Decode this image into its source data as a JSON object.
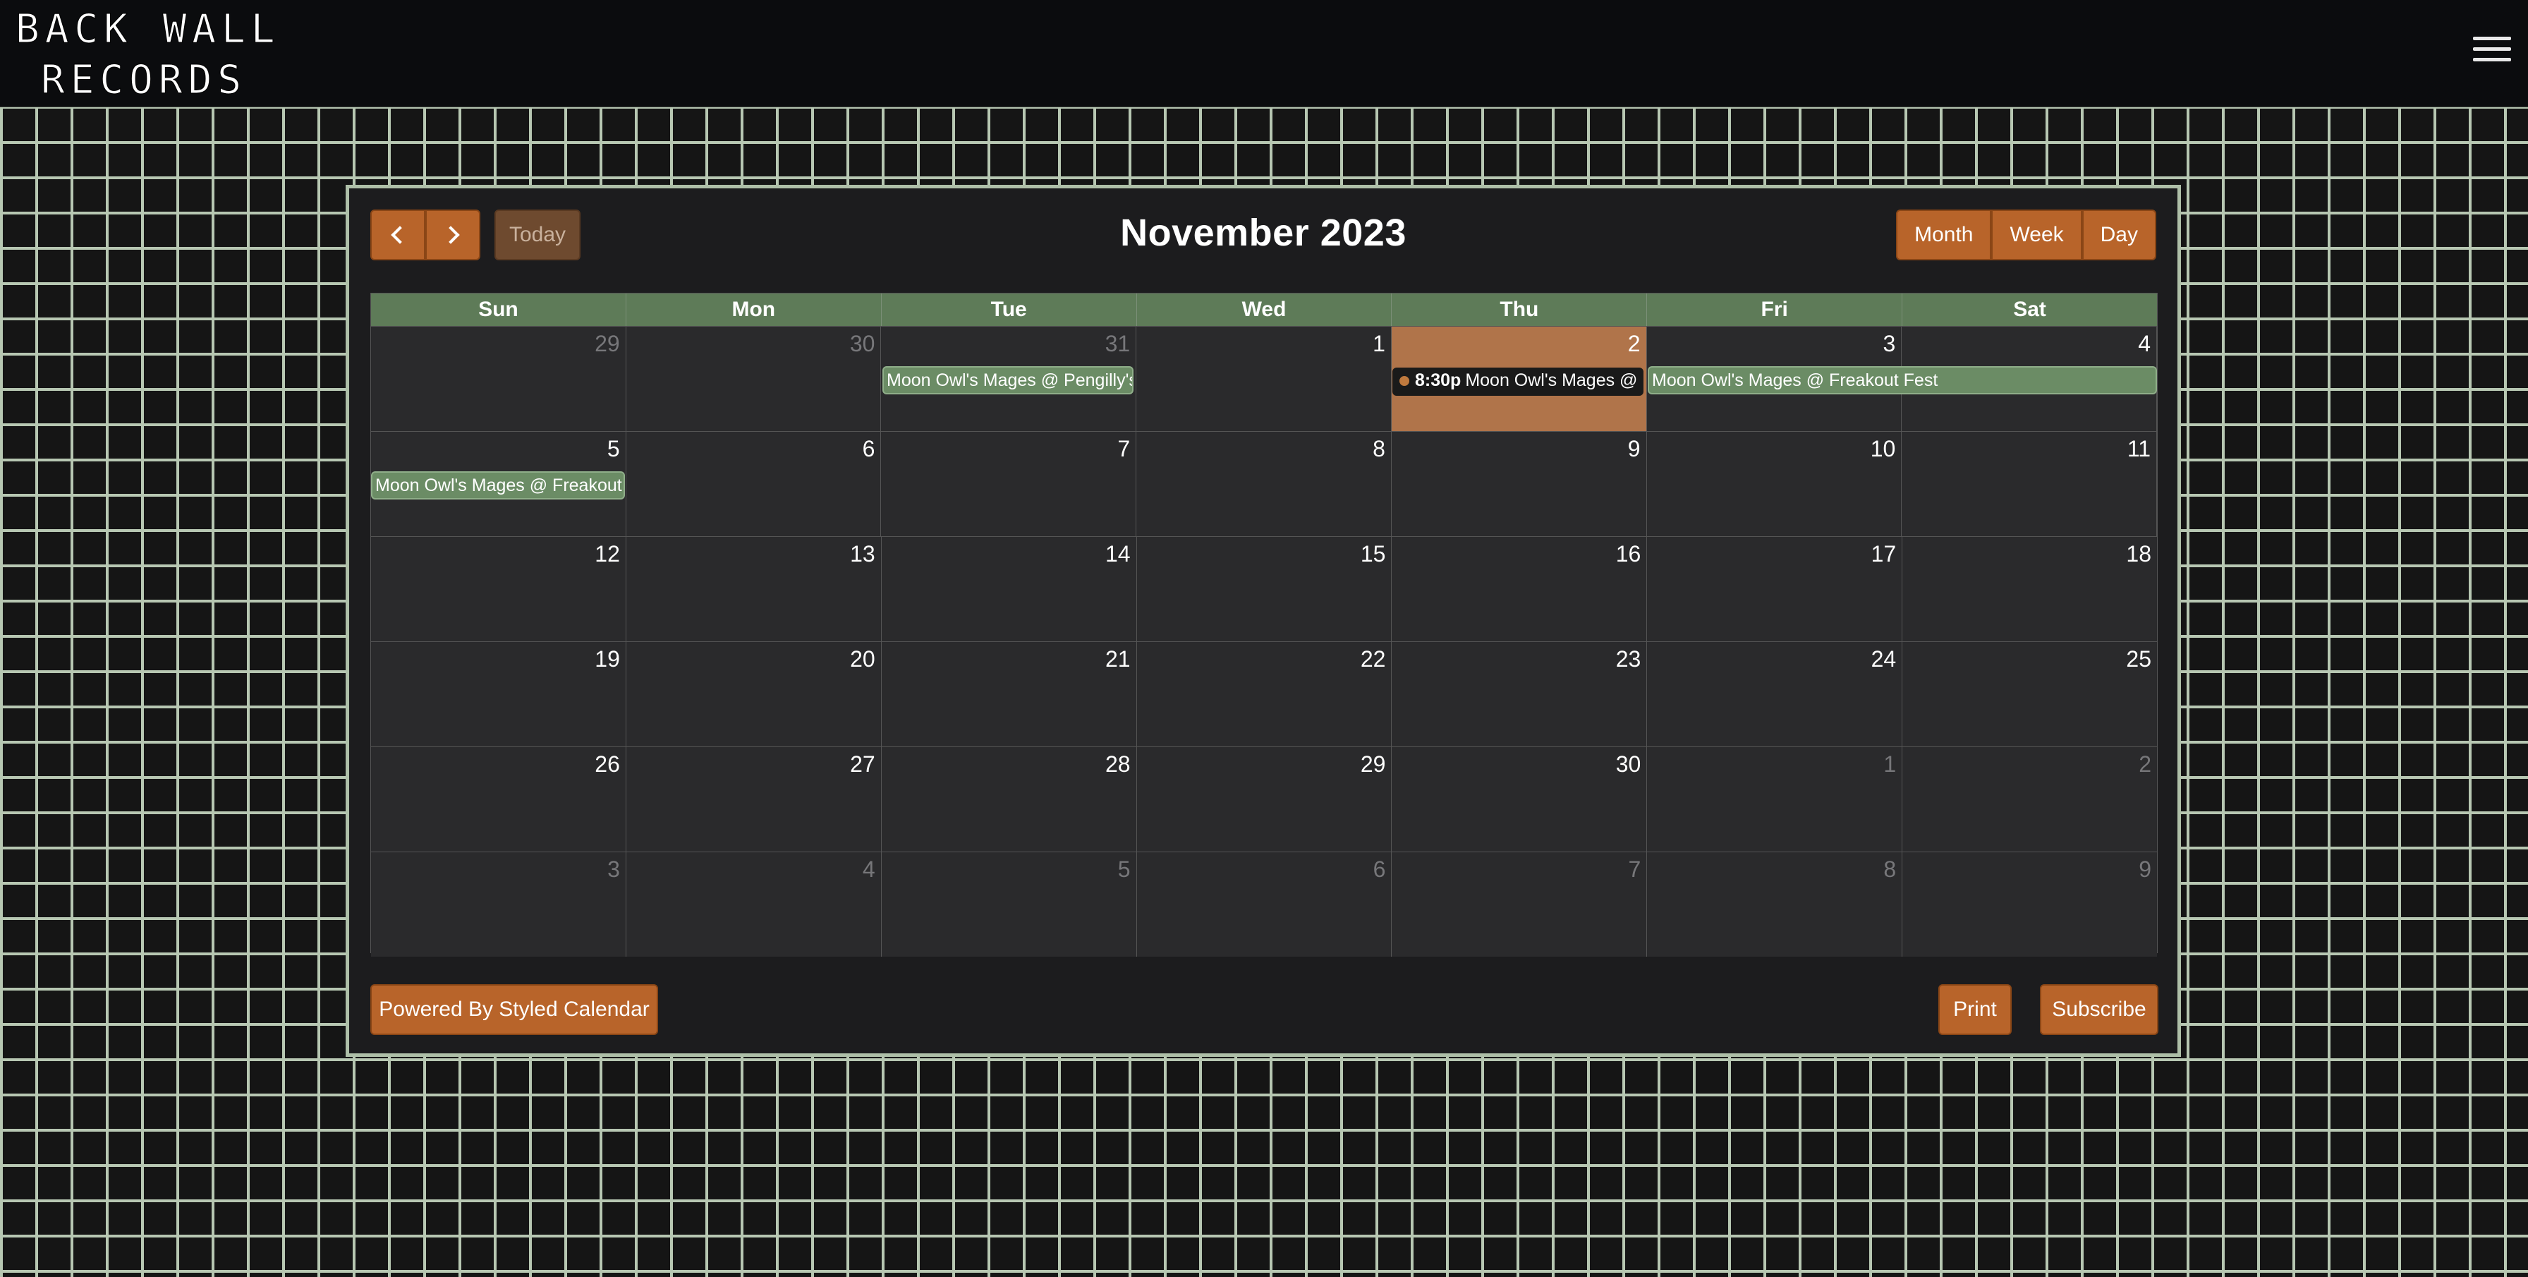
{
  "header": {
    "logo_line1": "BACK WALL",
    "logo_line2": "RECORDS",
    "menu_icon": "hamburger-menu-icon"
  },
  "calendar": {
    "title": "November 2023",
    "prev_icon": "chevron-left-icon",
    "next_icon": "chevron-right-icon",
    "today_label": "Today",
    "views": [
      "Month",
      "Week",
      "Day"
    ],
    "weekdays": [
      "Sun",
      "Mon",
      "Tue",
      "Wed",
      "Thu",
      "Fri",
      "Sat"
    ],
    "weeks": [
      [
        "29",
        "30",
        "31",
        "1",
        "2",
        "3",
        "4"
      ],
      [
        "5",
        "6",
        "7",
        "8",
        "9",
        "10",
        "11"
      ],
      [
        "12",
        "13",
        "14",
        "15",
        "16",
        "17",
        "18"
      ],
      [
        "19",
        "20",
        "21",
        "22",
        "23",
        "24",
        "25"
      ],
      [
        "26",
        "27",
        "28",
        "29",
        "30",
        "1",
        "2"
      ],
      [
        "3",
        "4",
        "5",
        "6",
        "7",
        "8",
        "9"
      ]
    ],
    "events": {
      "pengilly": "Moon Owl's Mages @ Pengilly's",
      "timed_time": "8:30p",
      "timed_title": "Moon Owl's Mages @ N",
      "freakout_1": "Moon Owl's Mages @ Freakout Fest",
      "freakout_2": "Moon Owl's Mages @ Freakout F"
    },
    "footer": {
      "powered": "Powered By Styled Calendar",
      "print": "Print",
      "subscribe": "Subscribe"
    }
  },
  "colors": {
    "accent": "#b8642a",
    "header_row": "#5e7b58",
    "event": "#6b8c65",
    "today_cell": "#b0744a",
    "frame": "#aebfa8"
  }
}
